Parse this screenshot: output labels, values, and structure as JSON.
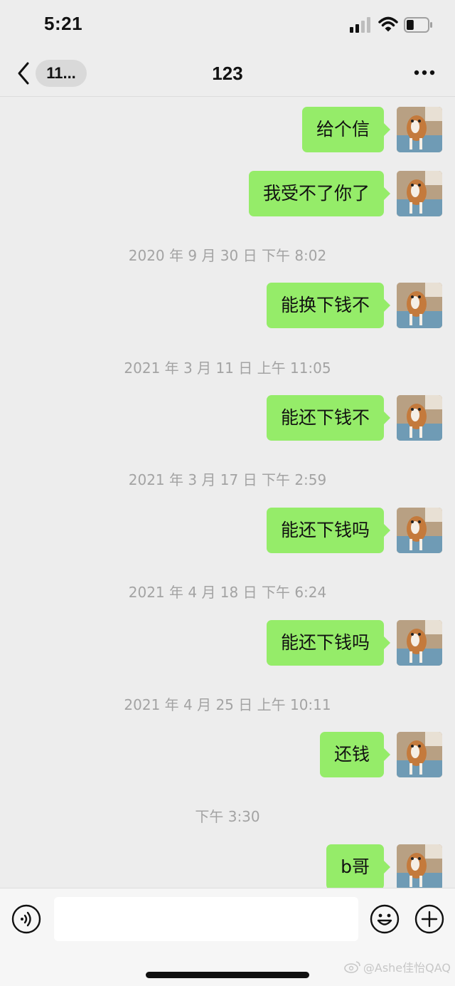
{
  "status_bar": {
    "time": "5:21",
    "battery_level": 0.35
  },
  "nav": {
    "back_badge": "11...",
    "title": "123"
  },
  "messages": [
    {
      "type": "text",
      "text": "给个信"
    },
    {
      "type": "text",
      "text": "我受不了你了"
    },
    {
      "type": "time",
      "text": "2020 年 9 月 30 日 下午 8:02"
    },
    {
      "type": "text",
      "text": "能换下钱不"
    },
    {
      "type": "time",
      "text": "2021 年 3 月 11 日 上午 11:05"
    },
    {
      "type": "text",
      "text": "能还下钱不"
    },
    {
      "type": "time",
      "text": "2021 年 3 月 17 日 下午 2:59"
    },
    {
      "type": "text",
      "text": "能还下钱吗"
    },
    {
      "type": "time",
      "text": "2021 年 4 月 18 日 下午 6:24"
    },
    {
      "type": "text",
      "text": "能还下钱吗"
    },
    {
      "type": "time",
      "text": "2021 年 4 月 25 日 上午 10:11"
    },
    {
      "type": "text",
      "text": "还钱"
    },
    {
      "type": "time",
      "text": "下午 3:30"
    },
    {
      "type": "text",
      "text": "b哥"
    }
  ],
  "input": {
    "value": ""
  },
  "watermark": "@Ashe佳怡QAQ",
  "colors": {
    "bubble": "#95ec69",
    "background": "#ededed",
    "timestamp": "#a3a3a3"
  },
  "icons": [
    "signal-icon",
    "wifi-icon",
    "battery-icon",
    "back-icon",
    "more-icon",
    "voice-icon",
    "emoji-icon",
    "plus-icon",
    "weibo-icon"
  ]
}
